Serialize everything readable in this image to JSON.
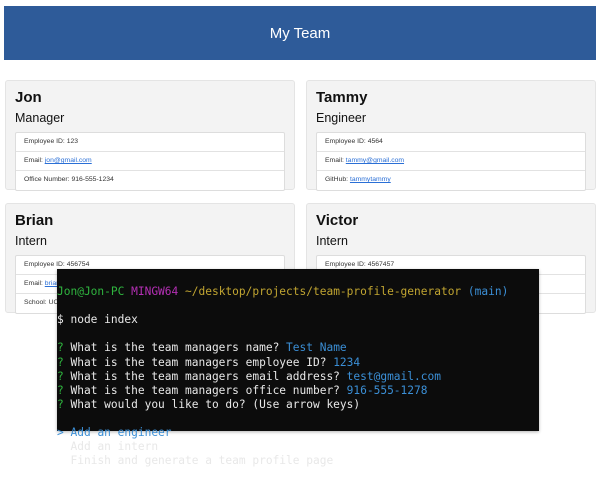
{
  "header": {
    "title": "My Team"
  },
  "cards": [
    {
      "name": "Jon",
      "role": "Manager",
      "items": [
        {
          "label": "Employee ID: ",
          "value": "123"
        },
        {
          "label": "Email: ",
          "link": "jon@gmail.com"
        },
        {
          "label": "Office Number: ",
          "value": "916-555-1234"
        }
      ]
    },
    {
      "name": "Tammy",
      "role": "Engineer",
      "items": [
        {
          "label": "Employee ID: ",
          "value": "4564"
        },
        {
          "label": "Email: ",
          "link": "tammy@gmail.com"
        },
        {
          "label": "GitHub: ",
          "link": "tammytammy"
        }
      ]
    },
    {
      "name": "Brian",
      "role": "Intern",
      "items": [
        {
          "label": "Employee ID: ",
          "value": "456754"
        },
        {
          "label": "Email: ",
          "link": "brian"
        },
        {
          "label": "School: ",
          "value": "UC"
        }
      ]
    },
    {
      "name": "Victor",
      "role": "Intern",
      "items": [
        {
          "label": "Employee ID: ",
          "value": "4567457"
        }
      ]
    }
  ],
  "terminal": {
    "user": "Jon@Jon-PC",
    "env": "MINGW64",
    "path": "~/desktop/projects/team-profile-generator",
    "branch": "(main)",
    "command": "$ node index",
    "qa": [
      {
        "q": "What is the team managers name? ",
        "a": "Test Name"
      },
      {
        "q": "What is the team managers employee ID? ",
        "a": "1234"
      },
      {
        "q": "What is the team managers email address? ",
        "a": "test@gmail.com"
      },
      {
        "q": "What is the team managers office number? ",
        "a": "916-555-1278"
      },
      {
        "q": "What would you like to do? (Use arrow keys)",
        "a": ""
      }
    ],
    "choices": [
      "Add an engineer",
      "Add an intern",
      "Finish and generate a team profile page"
    ],
    "selected_choice": "Add an engineer"
  },
  "colors": {
    "header": "#2e5b99",
    "link": "#2a6fd6",
    "terminal_bg": "#0c0c0c"
  }
}
